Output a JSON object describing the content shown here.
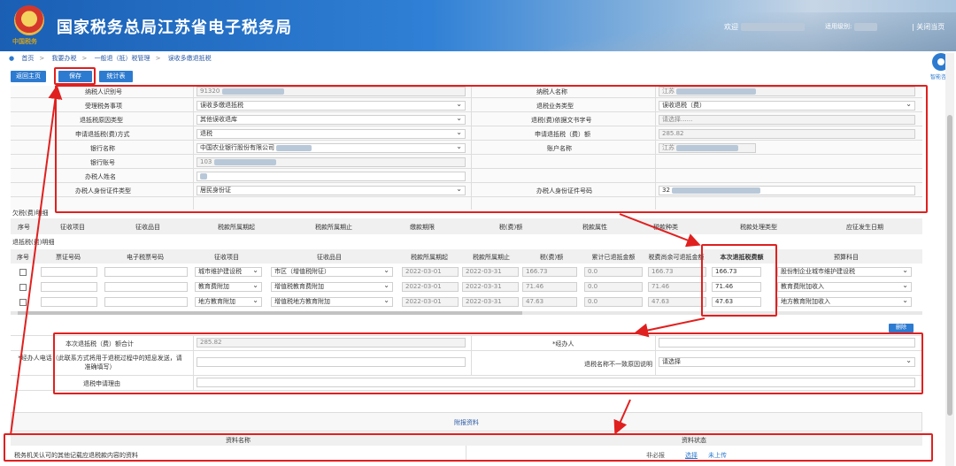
{
  "header": {
    "title": "国家税务总局江苏省电子税务局",
    "emblem_text": "中国税务",
    "welcome": "欢迎",
    "level_label": "适用级别:",
    "close_link": "| 关闭当页"
  },
  "breadcrumb": [
    "首页",
    ">",
    "我要办税",
    ">",
    "一般退（抵）税管理",
    ">",
    "误收多缴退抵税"
  ],
  "toolbar": {
    "home": "返回主页",
    "save": "保存",
    "stats": "统计表"
  },
  "side": {
    "label": "智能咨询"
  },
  "form": {
    "taxpayer_id_label": "纳税人识别号",
    "taxpayer_id_value": "91320",
    "taxpayer_name_label": "纳税人名称",
    "taxpayer_name_value": "江苏",
    "accept_item_label": "受理税务事项",
    "accept_item_value": "误收多缴退抵税",
    "refund_type_label": "退税业务类型",
    "refund_type_value": "误收退税（费）",
    "reason_type_label": "退抵税原因类型",
    "reason_type_value": "其他误收退库",
    "doc_no_label": "退税(费)依据文书字号",
    "doc_no_value": "请选择......",
    "method_label": "申请退抵税(费)方式",
    "method_value": "退税",
    "amount_label": "申请退抵税（费）额",
    "amount_value": "285.82",
    "bank_label": "银行名称",
    "bank_value": "中国农业银行股份有限公司",
    "account_name_label": "账户名称",
    "account_name_value": "江苏",
    "account_no_label": "银行账号",
    "account_no_value": "103",
    "handler_name_label": "办税人姓名",
    "handler_name_value": "",
    "id_type_label": "办税人身份证件类型",
    "id_type_value": "居民身份证",
    "id_no_label": "办税人身份证件号码",
    "id_no_value": "32"
  },
  "arrears": {
    "title": "欠税(费)明细",
    "columns": [
      "序号",
      "征收项目",
      "征收品目",
      "税款所属期起",
      "税款所属期止",
      "缴款期限",
      "税(费)额",
      "税款属性",
      "税款种类",
      "税款处理类型",
      "应征发生日期"
    ]
  },
  "refund": {
    "title": "退抵税(费)明细",
    "columns": [
      "序号",
      "票证号码",
      "电子税票号码",
      "征收项目",
      "征收品目",
      "税款所属期起",
      "税款所属期止",
      "税(费)额",
      "累计已退抵金额",
      "税费尚余可退抵金额",
      "本次退抵税费额",
      "预算科目"
    ],
    "rows": [
      {
        "item": "城市维护建设税",
        "sub": "市区（增值税附征）",
        "start": "2022-03-01",
        "end": "2022-03-31",
        "tax": "166.73",
        "refunded": "0.0",
        "remain": "166.73",
        "this": "166.73",
        "budget": "股份制企业城市维护建设税"
      },
      {
        "item": "教育费附加",
        "sub": "增值税教育费附加",
        "start": "2022-03-01",
        "end": "2022-03-31",
        "tax": "71.46",
        "refunded": "0.0",
        "remain": "71.46",
        "this": "71.46",
        "budget": "教育费附加收入"
      },
      {
        "item": "地方教育附加",
        "sub": "增值税地方教育附加",
        "start": "2022-03-01",
        "end": "2022-03-31",
        "tax": "47.63",
        "refunded": "0.0",
        "remain": "47.63",
        "this": "47.63",
        "budget": "地方教育附加收入"
      }
    ],
    "delete_btn": "删除"
  },
  "summary": {
    "total_label": "本次退抵税（费）额合计",
    "total_value": "285.82",
    "handler_label": "*经办人",
    "phone_label": "*经办人电话（此联系方式将用于退税过程中的短息发送，请准确填写）",
    "mismatch_label": "退税名称不一致原因说明",
    "mismatch_value": "请选择",
    "reason_label": "退税申请理由"
  },
  "attach": {
    "title": "附报资料",
    "col_name": "资料名称",
    "col_status": "资料状态",
    "row_name": "税务机关认可的其他记载应退税款内容的资料",
    "req": "非必报",
    "choose": "选择",
    "status": "未上传"
  }
}
